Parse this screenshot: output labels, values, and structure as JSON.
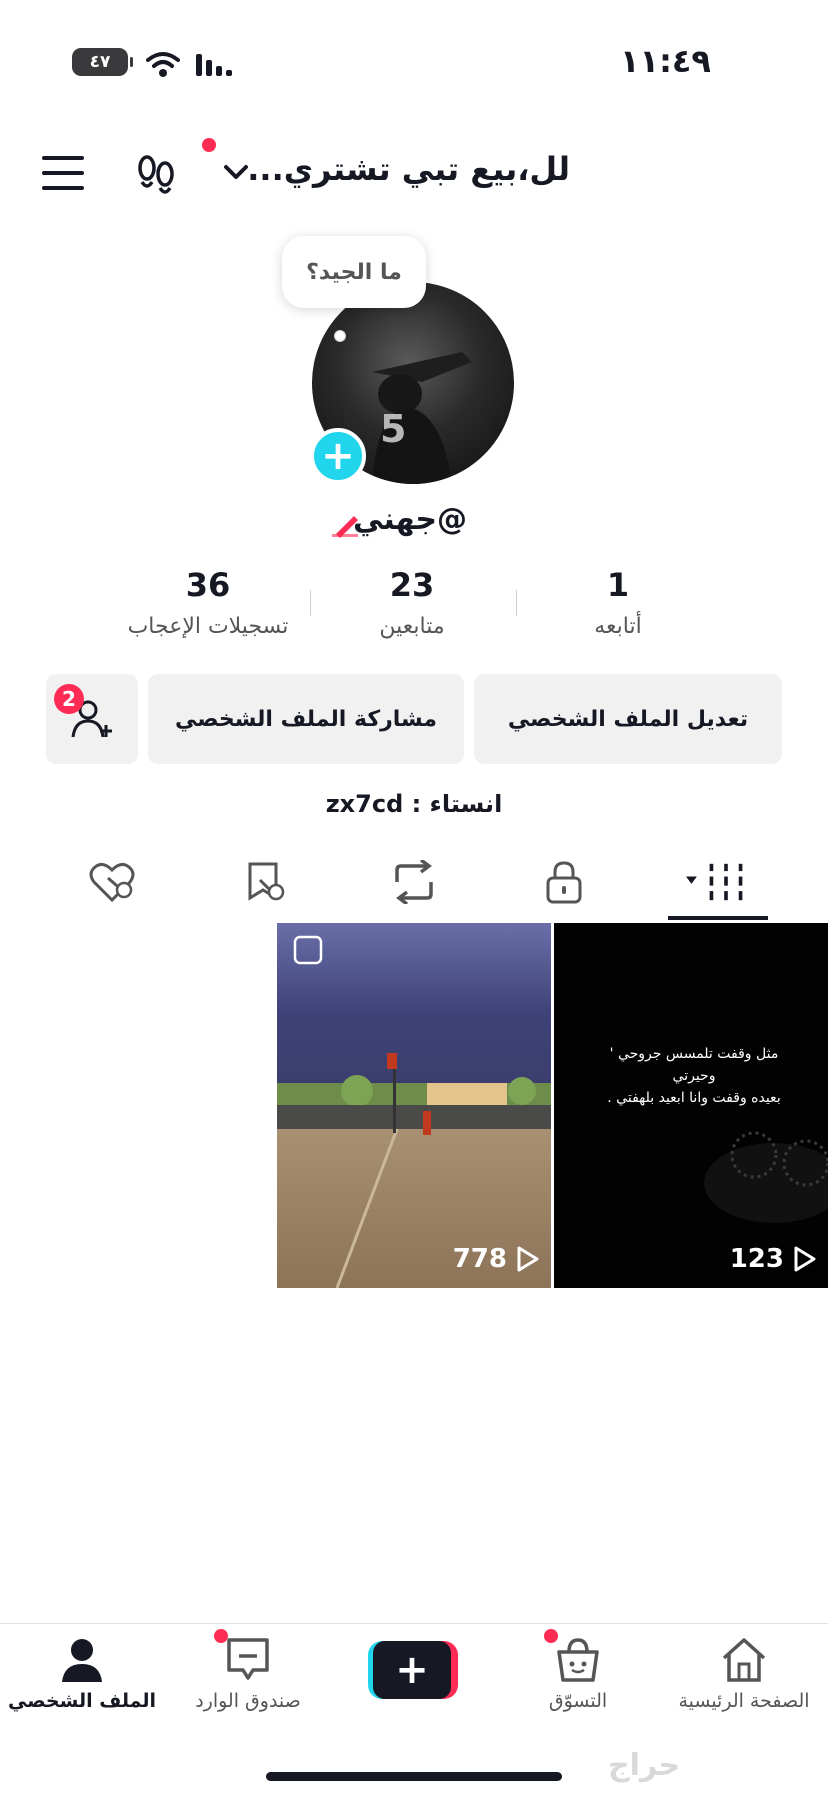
{
  "status_bar": {
    "time": "١١:٤٩",
    "battery": "٤٧"
  },
  "header": {
    "title": "لل،بيع تبي تشتري..."
  },
  "profile": {
    "bubble_text": "ما الجيد؟",
    "username": "@جهني",
    "stats": [
      {
        "value": "1",
        "label": "أتابعه"
      },
      {
        "value": "23",
        "label": "متابعين"
      },
      {
        "value": "36",
        "label": "تسجيلات الإعجاب"
      }
    ],
    "edit_label": "تعديل الملف الشخصي",
    "share_label": "مشاركة الملف الشخصي",
    "friends_badge": "2",
    "bio": "انستاء : zx7cd"
  },
  "videos": [
    {
      "views": "123",
      "caption": "مثل وقفت تلمسس جروحي '\nوحيرتي\nبعيده وقفت وانا ابعيد بلهفتي ."
    },
    {
      "views": "778"
    }
  ],
  "bottom_nav": {
    "home": "الصفحة الرئيسية",
    "shop": "التسوّق",
    "inbox": "صندوق الوارد",
    "profile": "الملف الشخصي"
  },
  "watermark": "حراج",
  "colors": {
    "accent_red": "#fe2c55",
    "accent_cyan": "#20d5ec",
    "text": "#161823"
  }
}
